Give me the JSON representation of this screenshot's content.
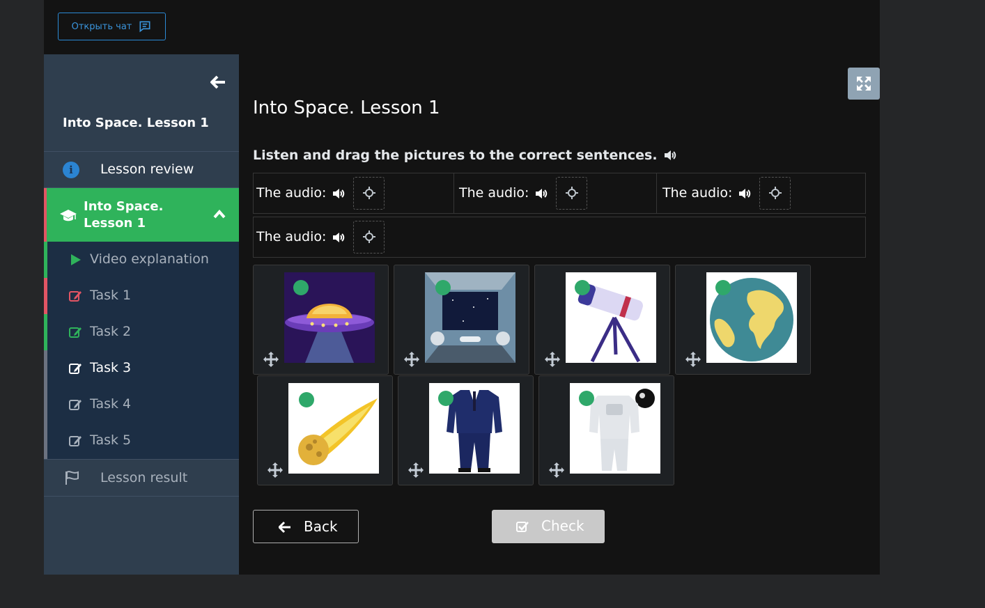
{
  "chat_button": {
    "label": "Открыть чат"
  },
  "sidebar": {
    "lesson_title": "Into Space. Lesson 1",
    "review_label": "Lesson review",
    "active_section_label": "Into Space. Lesson 1",
    "items": [
      {
        "label": "Video explanation",
        "icon": "play-icon",
        "state": "done",
        "bar_color": "#2fb35b"
      },
      {
        "label": "Task 1",
        "icon": "edit-icon",
        "state": "wrong",
        "bar_color": "#e25564"
      },
      {
        "label": "Task 2",
        "icon": "edit-icon",
        "state": "correct",
        "bar_color": "#2fb35b"
      },
      {
        "label": "Task 3",
        "icon": "edit-icon",
        "state": "current",
        "bar_color": "#6b7280"
      },
      {
        "label": "Task 4",
        "icon": "edit-icon",
        "state": "todo",
        "bar_color": "#6b7280"
      },
      {
        "label": "Task 5",
        "icon": "edit-icon",
        "state": "todo",
        "bar_color": "#6b7280"
      }
    ],
    "result_label": "Lesson result"
  },
  "main": {
    "title": "Into Space. Lesson 1",
    "instruction": "Listen and drag the pictures to the correct sentences.",
    "sentences": [
      {
        "label": "The audio:"
      },
      {
        "label": "The audio:"
      },
      {
        "label": "The audio:"
      },
      {
        "label": "The audio:"
      }
    ],
    "pictures": [
      {
        "name": "ufo"
      },
      {
        "name": "spaceship-interior"
      },
      {
        "name": "telescope"
      },
      {
        "name": "earth"
      },
      {
        "name": "comet"
      },
      {
        "name": "pilot-uniform"
      },
      {
        "name": "spacesuit"
      }
    ],
    "back_label": "Back",
    "check_label": "Check"
  },
  "colors": {
    "accent_green": "#2fb35b",
    "accent_red": "#e25564",
    "accent_blue": "#2b8ad6"
  }
}
